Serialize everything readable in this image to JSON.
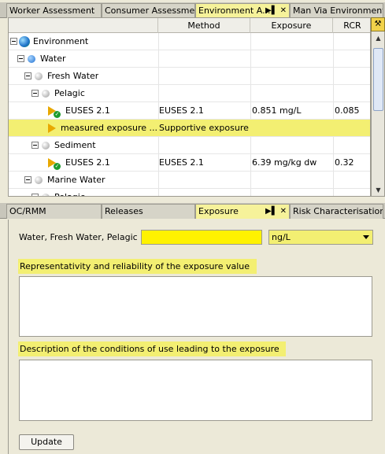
{
  "top_tabs": [
    {
      "label": "Worker Assessment"
    },
    {
      "label": "Consumer Assessment"
    },
    {
      "label": "Environment A..."
    },
    {
      "label": "Man Via Environment..."
    }
  ],
  "tab_controls": {
    "pin": "▶▌",
    "close": "✕"
  },
  "tree": {
    "columns": [
      "",
      "Method",
      "Exposure",
      "RCR"
    ],
    "rows": [
      {
        "label": "Environment"
      },
      {
        "label": "Water"
      },
      {
        "label": "Fresh Water"
      },
      {
        "label": "Pelagic"
      },
      {
        "label": "EUSES 2.1",
        "method": "EUSES 2.1",
        "exposure": "0.851 mg/L",
        "rcr": "0.085"
      },
      {
        "label": "measured exposure ...",
        "method": "Supportive exposure"
      },
      {
        "label": "Sediment"
      },
      {
        "label": "EUSES 2.1",
        "method": "EUSES 2.1",
        "exposure": "6.39 mg/kg dw",
        "rcr": "0.32"
      },
      {
        "label": "Marine Water"
      },
      {
        "label": "Pelagic"
      }
    ]
  },
  "bottom_tabs": [
    {
      "label": "OC/RMM"
    },
    {
      "label": "Releases"
    },
    {
      "label": "Exposure"
    },
    {
      "label": "Risk Characterisation"
    }
  ],
  "form": {
    "location_label": "Water, Fresh Water, Pelagic",
    "exposure_value": "",
    "unit_selected": "ng/L",
    "representativity_label": "Representativity and reliability of the exposure value",
    "representativity_value": "",
    "description_label": "Description of the conditions of use leading to the exposure",
    "description_value": "",
    "update_label": "Update"
  },
  "colors": {
    "highlight": "#f3ef72",
    "input_yellow": "#fff200",
    "window_bg": "#ece9d8"
  },
  "icons": [
    "environment-globe-icon",
    "blue-ball-icon",
    "grey-ball-icon",
    "scenario-play-icon",
    "ok-check-icon",
    "corner-settings-icon"
  ]
}
